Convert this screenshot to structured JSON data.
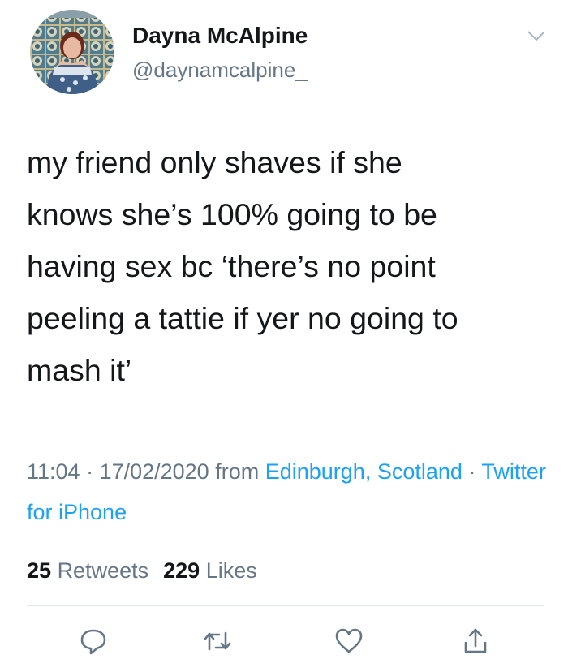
{
  "author": {
    "name": "Dayna McAlpine",
    "handle": "@daynamcalpine_"
  },
  "tweet": {
    "text": "my friend only shaves if she\nknows she’s 100% going to be\nhaving sex bc ‘there’s no point\npeeling a tattie if yer no going to\nmash it’"
  },
  "meta": {
    "time": "11:04",
    "sep1": " · ",
    "date": "17/02/2020",
    "from": " from ",
    "location": "Edinburgh, Scotland",
    "sep2": " · ",
    "source": "Twitter for iPhone"
  },
  "stats": {
    "retweets_count": "25",
    "retweets_label": "Retweets",
    "likes_count": "229",
    "likes_label": "Likes"
  },
  "icons": {
    "menu": "chevron-down-icon",
    "reply": "reply-icon",
    "retweet": "retweet-icon",
    "like": "heart-icon",
    "share": "share-icon"
  },
  "colors": {
    "link": "#1da1f2",
    "secondary_text": "#657786",
    "primary_text": "#14171a",
    "divider": "#e1e8ed"
  }
}
